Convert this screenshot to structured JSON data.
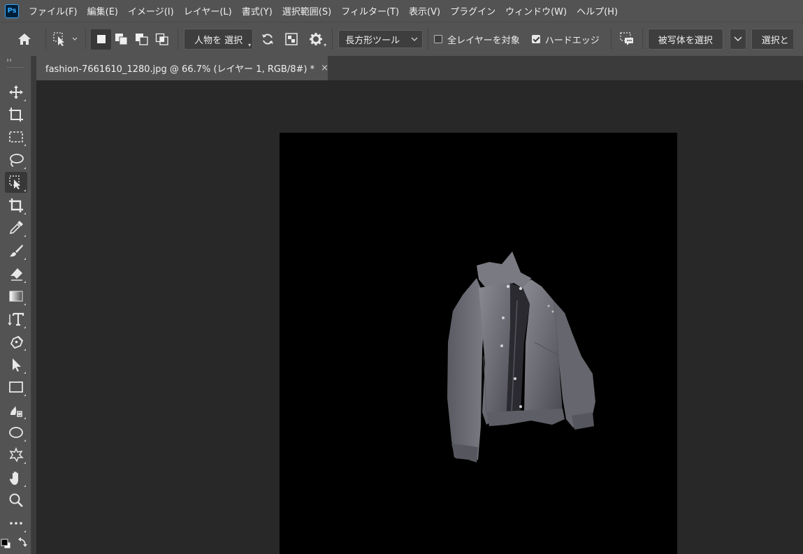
{
  "menu": {
    "items": [
      {
        "label": "ファイル(F)"
      },
      {
        "label": "編集(E)"
      },
      {
        "label": "イメージ(I)"
      },
      {
        "label": "レイヤー(L)"
      },
      {
        "label": "書式(Y)"
      },
      {
        "label": "選択範囲(S)"
      },
      {
        "label": "フィルター(T)"
      },
      {
        "label": "表示(V)"
      },
      {
        "label": "プラグイン"
      },
      {
        "label": "ウィンドウ(W)"
      },
      {
        "label": "ヘルプ(H)"
      }
    ],
    "logo": "Ps"
  },
  "options": {
    "select_people": "人物を 選択",
    "mode_value": "長方形ツール",
    "sample_all_layers": "全レイヤーを対象",
    "sample_all_layers_checked": false,
    "hard_edge": "ハードエッジ",
    "hard_edge_checked": true,
    "select_subject": "被写体を選択",
    "select_and_mask": "選択と"
  },
  "document": {
    "tab_title": "fashion-7661610_1280.jpg @ 66.7% (レイヤー 1, RGB/8#) *",
    "close_symbol": "×"
  },
  "toolbar": {
    "collapse": "››",
    "active_tool": "object-selection-tool"
  },
  "colors": {
    "panel": "#535353",
    "panel_dark": "#3b3b3b",
    "workspace": "#282828",
    "accent": "#31a8ff"
  }
}
